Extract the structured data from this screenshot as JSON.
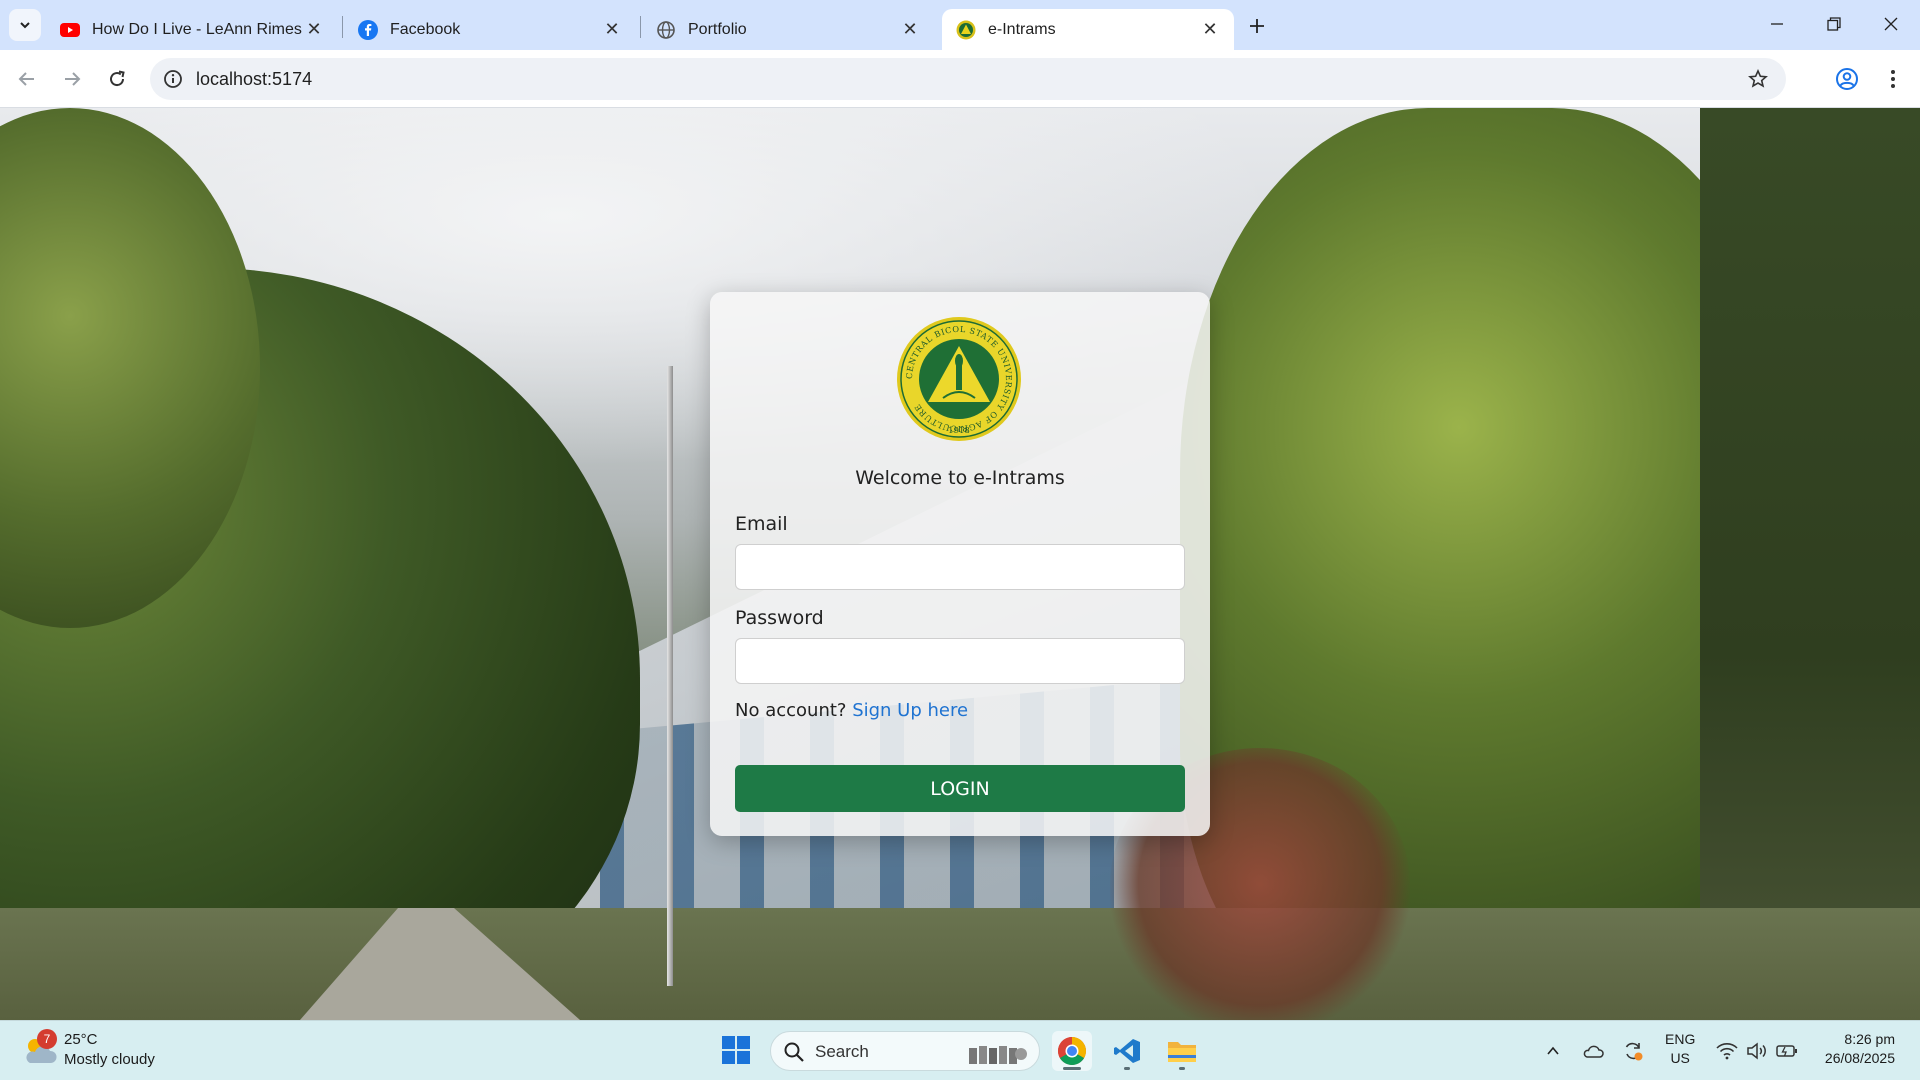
{
  "browser": {
    "tabs": [
      {
        "title": "How Do I Live - LeAnn Rimes (T",
        "icon": "youtube-icon",
        "active": false
      },
      {
        "title": "Facebook",
        "icon": "facebook-icon",
        "active": false
      },
      {
        "title": "Portfolio",
        "icon": "globe-icon",
        "active": false
      },
      {
        "title": "e-Intrams",
        "icon": "site-logo-icon",
        "active": true
      }
    ],
    "url": "localhost:5174"
  },
  "login": {
    "welcome": "Welcome to e-Intrams",
    "email_label": "Email",
    "email_value": "",
    "password_label": "Password",
    "password_value": "",
    "no_account_text": "No account?",
    "signup_link": "Sign Up here",
    "login_button": "LOGIN",
    "logo_text": "CENTRAL BICOL STATE UNIVERSITY OF AGRICULTURE",
    "logo_year": "1918"
  },
  "taskbar": {
    "weather": {
      "temp": "25°C",
      "desc": "Mostly cloudy",
      "badge": "7"
    },
    "search_placeholder": "Search",
    "tray": {
      "lang_line1": "ENG",
      "lang_line2": "US",
      "time": "8:26 pm",
      "date": "26/08/2025"
    }
  },
  "colors": {
    "accent_green": "#1e7a46",
    "link_blue": "#1f73d1",
    "tabstrip_bg": "#d3e3fd",
    "taskbar_bg": "#d7eef1"
  }
}
